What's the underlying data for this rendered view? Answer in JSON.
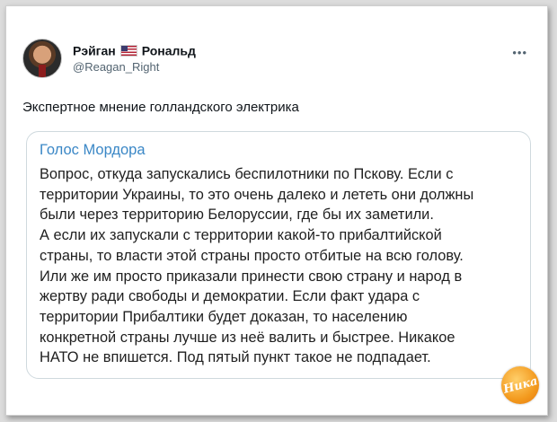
{
  "post": {
    "author_name": "Рэйган",
    "author_surname": "Рональд",
    "handle": "@Reagan_Right",
    "more_icon": "•••",
    "text": "Экспертное мнение голландского электрика"
  },
  "quote": {
    "title": "Голос Мордора",
    "lines": [
      "Вопрос, откуда запускались беспилотники по Пскову. Если с",
      "территории Украины, то это очень далеко и лететь они должны",
      "были через территорию Белоруссии, где бы их заметили.",
      "А если их запускали с территории какой-то прибалтийской",
      "страны, то власти этой страны просто отбитые на всю голову.",
      "Или же им просто приказали принести свою страну и народ в",
      "жертву ради свободы и демократии. Если факт удара с",
      "территории Прибалтики будет доказан, то населению",
      "конкретной страны лучше из неё валить и быстрее. Никакое",
      "НАТО не впишется. Под пятый пункт такое не подпадает."
    ]
  },
  "watermark": {
    "text": "Ника"
  },
  "colors": {
    "quote_title": "#3a87c6",
    "text": "#0f1419",
    "secondary": "#536471"
  }
}
